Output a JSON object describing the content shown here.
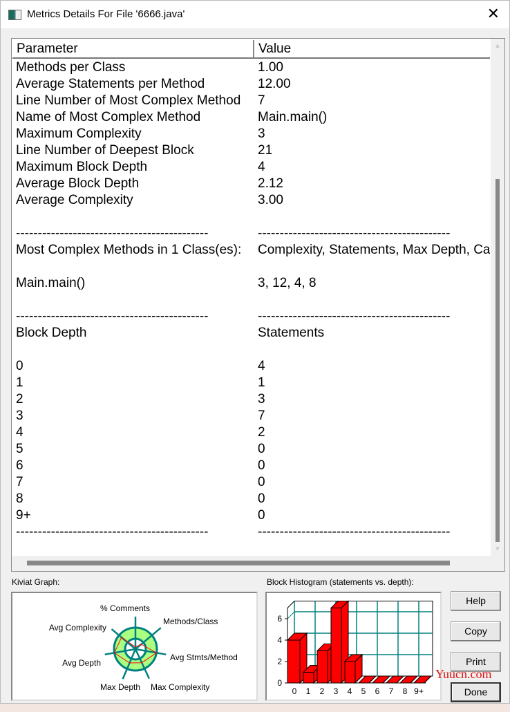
{
  "window": {
    "title": "Metrics Details For File '6666.java'",
    "close": "✕"
  },
  "table": {
    "headers": {
      "parameter": "Parameter",
      "value": "Value"
    },
    "rows": [
      {
        "p": "Methods per Class",
        "v": "1.00"
      },
      {
        "p": "Average Statements per Method",
        "v": "12.00"
      },
      {
        "p": "Line Number of Most Complex Method",
        "v": "7"
      },
      {
        "p": "Name of Most Complex Method",
        "v": "Main.main()"
      },
      {
        "p": "Maximum Complexity",
        "v": "3"
      },
      {
        "p": "Line Number of Deepest Block",
        "v": "21"
      },
      {
        "p": "Maximum Block Depth",
        "v": "4"
      },
      {
        "p": "Average Block Depth",
        "v": "2.12"
      },
      {
        "p": "Average Complexity",
        "v": "3.00"
      },
      {
        "p": "",
        "v": ""
      },
      {
        "p": "--------------------------------------------",
        "v": "--------------------------------------------"
      },
      {
        "p": "Most Complex Methods in 1 Class(es):",
        "v": "Complexity, Statements, Max Depth, Calls"
      },
      {
        "p": "",
        "v": ""
      },
      {
        "p": "Main.main()",
        "v": "3, 12, 4, 8"
      },
      {
        "p": "",
        "v": ""
      },
      {
        "p": "--------------------------------------------",
        "v": "--------------------------------------------"
      },
      {
        "p": "Block Depth",
        "v": "Statements"
      },
      {
        "p": "",
        "v": ""
      },
      {
        "p": "0",
        "v": "4"
      },
      {
        "p": "1",
        "v": "1"
      },
      {
        "p": "2",
        "v": "3"
      },
      {
        "p": "3",
        "v": "7"
      },
      {
        "p": "4",
        "v": "2"
      },
      {
        "p": "5",
        "v": "0"
      },
      {
        "p": "6",
        "v": "0"
      },
      {
        "p": "7",
        "v": "0"
      },
      {
        "p": "8",
        "v": "0"
      },
      {
        "p": "9+",
        "v": "0"
      },
      {
        "p": "--------------------------------------------",
        "v": "--------------------------------------------"
      }
    ]
  },
  "kiviat": {
    "label": "Kiviat Graph:",
    "axes": [
      "% Comments",
      "Methods/Class",
      "Avg Stmts/Method",
      "Max Complexity",
      "Max Depth",
      "Avg Depth",
      "Avg Complexity"
    ],
    "colors": {
      "ring": "#aaff80",
      "axis": "#008080",
      "polygon": "#ff0000"
    }
  },
  "histogram": {
    "label": "Block Histogram (statements vs. depth):"
  },
  "chart_data": {
    "type": "bar",
    "title": "Block Histogram (statements vs. depth):",
    "categories": [
      "0",
      "1",
      "2",
      "3",
      "4",
      "5",
      "6",
      "7",
      "8",
      "9+"
    ],
    "values": [
      4,
      1,
      3,
      7,
      2,
      0,
      0,
      0,
      0,
      0
    ],
    "yticks": [
      0,
      2,
      4,
      6
    ],
    "ylim": [
      0,
      7
    ],
    "grid": true,
    "bar_color": "#ff0000",
    "grid_color": "#008080"
  },
  "buttons": {
    "help": "Help",
    "copy": "Copy",
    "print": "Print",
    "done": "Done"
  },
  "watermark": "Yuucn.com"
}
